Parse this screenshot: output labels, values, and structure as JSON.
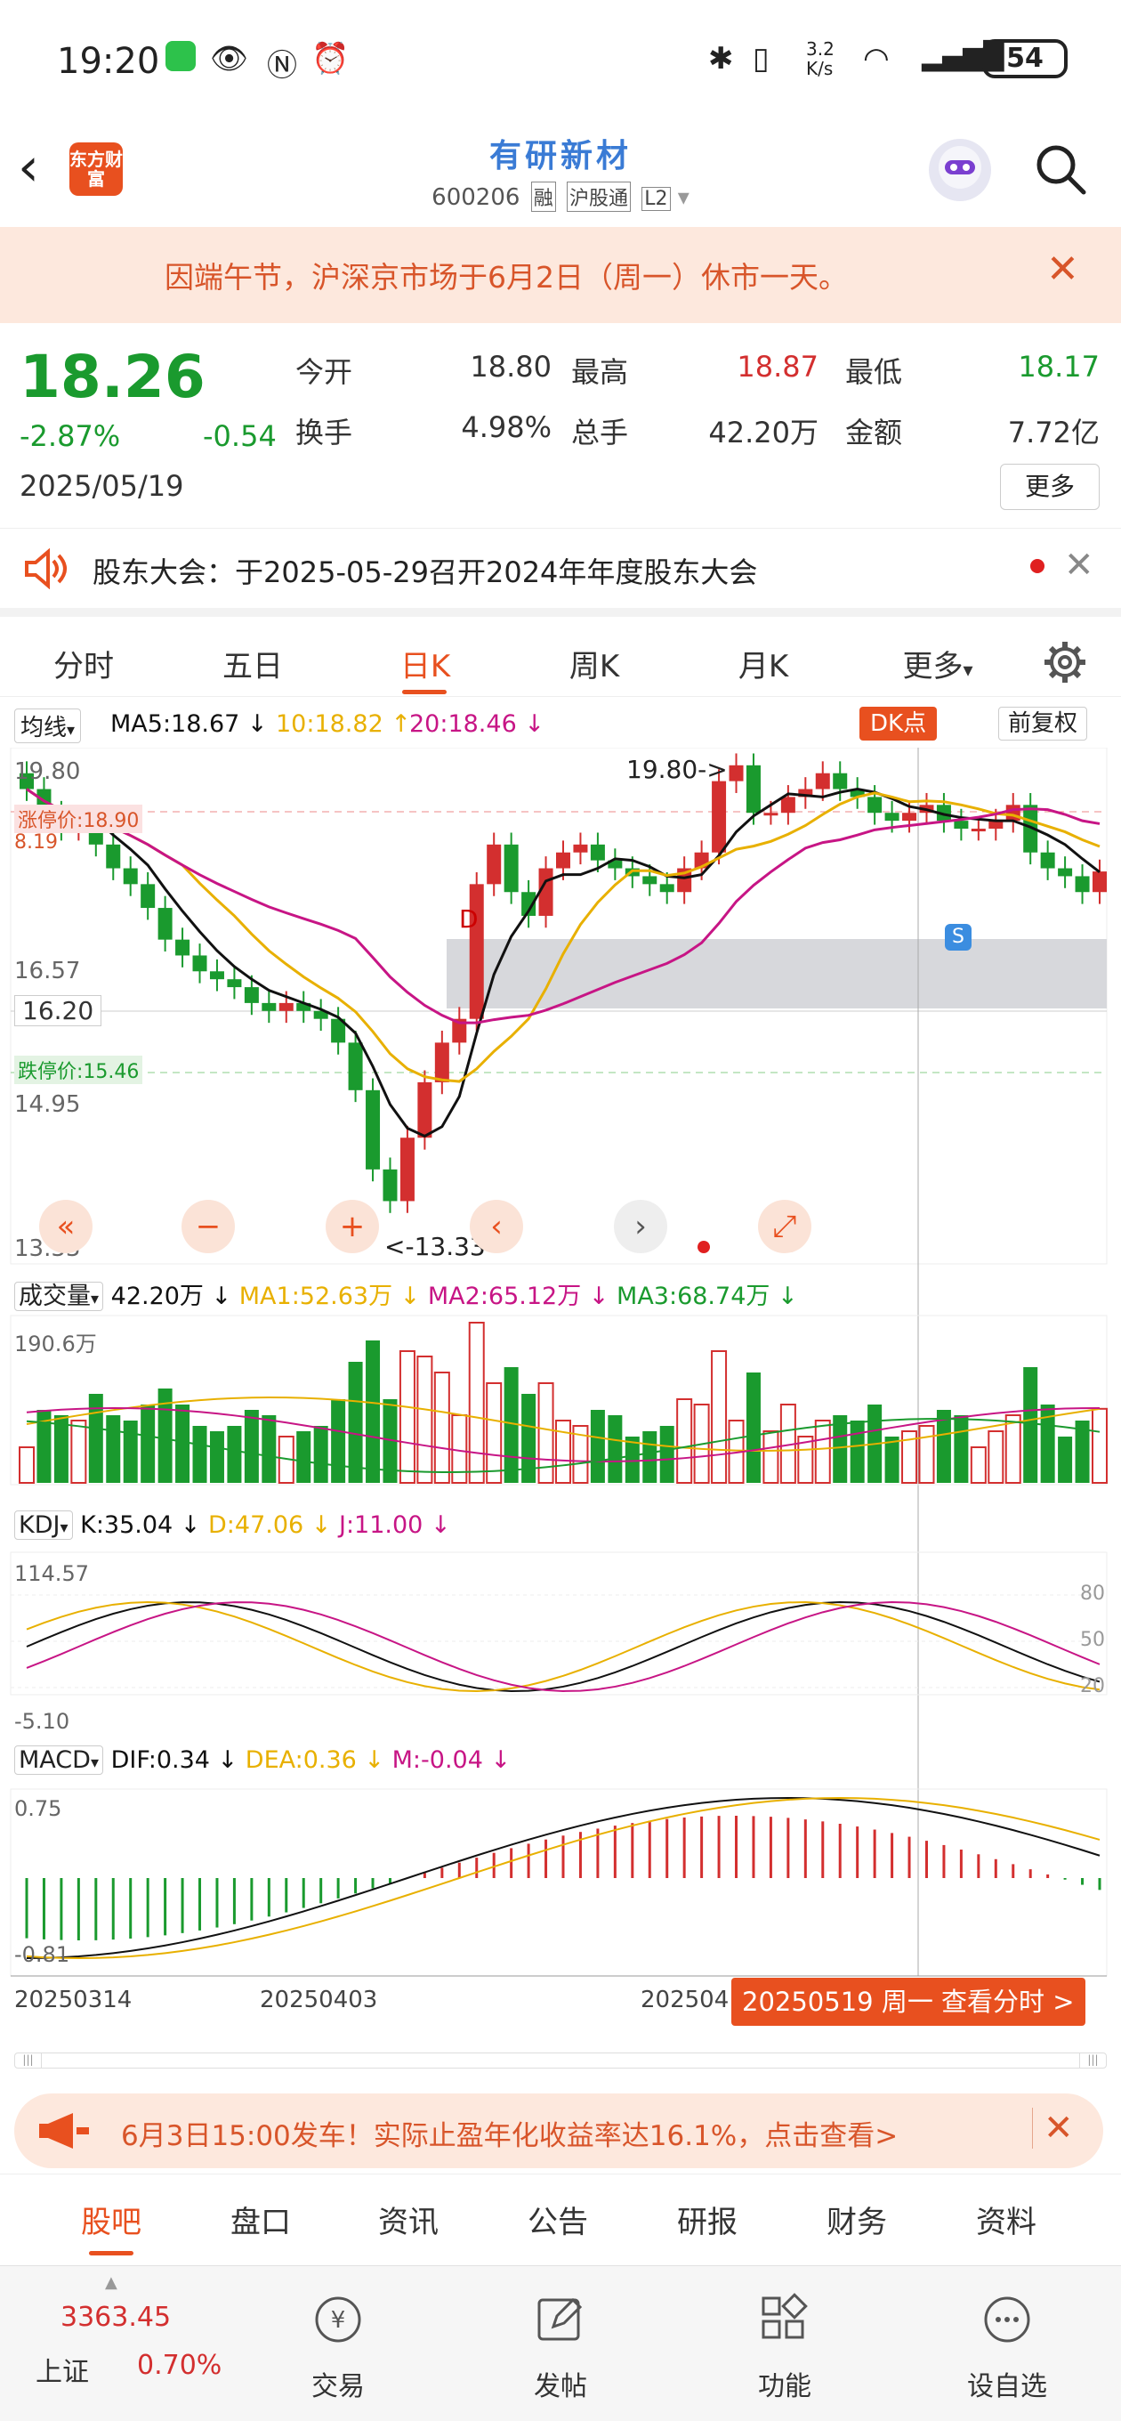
{
  "status_bar": {
    "time": "19:20",
    "network_speed": "3.2 K/s",
    "battery": "54"
  },
  "header": {
    "title": "有研新材",
    "code": "600206",
    "tags": [
      "融",
      "沪股通",
      "L2"
    ],
    "logo_text": "东方财富"
  },
  "notice": {
    "text": "因端午节，沪深京市场于6月2日（周一）休市一天。"
  },
  "quote": {
    "price": "18.26",
    "change_pct": "-2.87%",
    "change": "-0.54",
    "date": "2025/05/19",
    "open_label": "今开",
    "open": "18.80",
    "high_label": "最高",
    "high": "18.87",
    "low_label": "最低",
    "low": "18.17",
    "turnover_label": "换手",
    "turnover": "4.98%",
    "volume_label": "总手",
    "volume": "42.20万",
    "amount_label": "金额",
    "amount": "7.72亿",
    "more": "更多"
  },
  "meeting": {
    "text": "股东大会：于2025-05-29召开2024年年度股东大会"
  },
  "tabs": [
    "分时",
    "五日",
    "日K",
    "周K",
    "月K",
    "更多"
  ],
  "active_tab": "日K",
  "ma_bar": {
    "selector": "均线",
    "ma5": "MA5:18.67 ↓",
    "ma10": "10:18.82 ↑",
    "ma20": "20:18.46 ↓",
    "dk": "DK点",
    "fq": "前复权"
  },
  "kline_labels": {
    "top": "19.80",
    "mid": "16.57",
    "low": "14.95",
    "bottom": "13.33",
    "cursor_price": "16.20",
    "limit_up": "涨停价:18.90",
    "limit_down": "跌停价:15.46",
    "peak": "19.80->",
    "trough": "<-13.33",
    "limit_up_short": "8.19"
  },
  "volume_bar": {
    "selector": "成交量",
    "vol": "42.20万 ↓",
    "ma1": "MA1:52.63万 ↓",
    "ma2": "MA2:65.12万 ↓",
    "ma3": "MA3:68.74万 ↓",
    "max": "190.6万"
  },
  "kdj_bar": {
    "selector": "KDJ",
    "k": "K:35.04 ↓",
    "d": "D:47.06 ↓",
    "j": "J:11.00 ↓",
    "max": "114.57",
    "min": "-5.10",
    "l80": "80",
    "l50": "50",
    "l20": "20"
  },
  "macd_bar": {
    "selector": "MACD",
    "dif": "DIF:0.34 ↓",
    "dea": "DEA:0.36 ↓",
    "m": "M:-0.04 ↓",
    "max": "0.75",
    "min": "-0.81"
  },
  "x_axis": {
    "d1": "20250314",
    "d2": "20250403",
    "d3": "202504",
    "cursor": "20250519 周一 查看分时 >"
  },
  "promo": {
    "text": "6月3日15:00发车！实际止盈年化收益率达16.1%，点击查看>"
  },
  "bottom_tabs": [
    "股吧",
    "盘口",
    "资讯",
    "公告",
    "研报",
    "财务",
    "资料"
  ],
  "dock": {
    "index_value": "3363.45",
    "index_name": "上证",
    "index_pct": "0.70%",
    "trade": "交易",
    "post": "发帖",
    "func": "功能",
    "watch": "设自选"
  },
  "colors": {
    "up": "#d32f2f",
    "down": "#1a9a2e",
    "accent": "#e8501f",
    "ma5": "#111111",
    "ma10": "#e8b000",
    "ma20": "#c71585"
  }
}
